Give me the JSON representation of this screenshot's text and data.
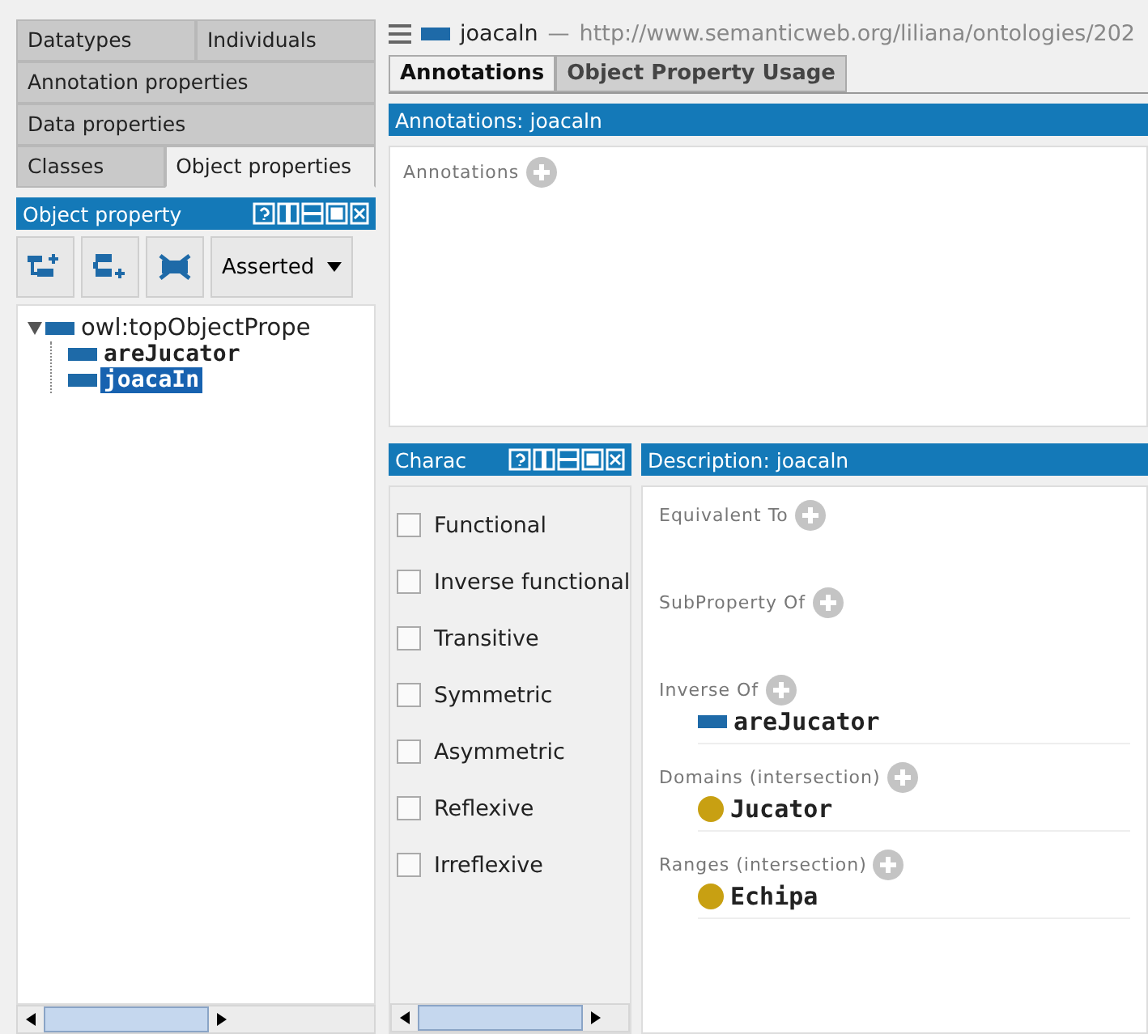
{
  "left_tabs": [
    [
      {
        "label": "Datatypes",
        "selected": false
      },
      {
        "label": "Individuals",
        "selected": false
      }
    ],
    [
      {
        "label": "Annotation properties",
        "selected": false
      }
    ],
    [
      {
        "label": "Data properties",
        "selected": false
      }
    ],
    [
      {
        "label": "Classes",
        "selected": false
      },
      {
        "label": "Object properties",
        "selected": true
      }
    ]
  ],
  "hierarchy": {
    "title": "Object property",
    "view": "Asserted",
    "tree": [
      {
        "label": "owl:topObjectPrope",
        "expanded": true,
        "selected": false,
        "children": [
          {
            "label": "areJucator",
            "selected": false
          },
          {
            "label": "joacaIn",
            "selected": true
          }
        ]
      }
    ]
  },
  "entity": {
    "name": "joacaln",
    "separator": "—",
    "iri": "http://www.semanticweb.org/liliana/ontologies/202"
  },
  "tabs": [
    {
      "label": "Annotations",
      "selected": true
    },
    {
      "label": "Object Property Usage",
      "selected": false
    }
  ],
  "annotations": {
    "title": "Annotations: joacaln",
    "label": "Annotations"
  },
  "characteristics": {
    "title": "Charac",
    "items": [
      {
        "label": "Functional",
        "checked": false
      },
      {
        "label": "Inverse functional",
        "checked": false
      },
      {
        "label": "Transitive",
        "checked": false
      },
      {
        "label": "Symmetric",
        "checked": false
      },
      {
        "label": "Asymmetric",
        "checked": false
      },
      {
        "label": "Reflexive",
        "checked": false
      },
      {
        "label": "Irreflexive",
        "checked": false
      }
    ]
  },
  "description": {
    "title": "Description: joacaln",
    "sections": [
      {
        "label": "Equivalent To"
      },
      {
        "label": "SubProperty Of"
      },
      {
        "label": "Inverse Of",
        "items": [
          {
            "kind": "property",
            "label": "areJucator"
          }
        ]
      },
      {
        "label": "Domains (intersection)",
        "items": [
          {
            "kind": "class",
            "label": "Jucator"
          }
        ]
      },
      {
        "label": "Ranges (intersection)",
        "items": [
          {
            "kind": "class",
            "label": "Echipa"
          }
        ]
      }
    ]
  }
}
